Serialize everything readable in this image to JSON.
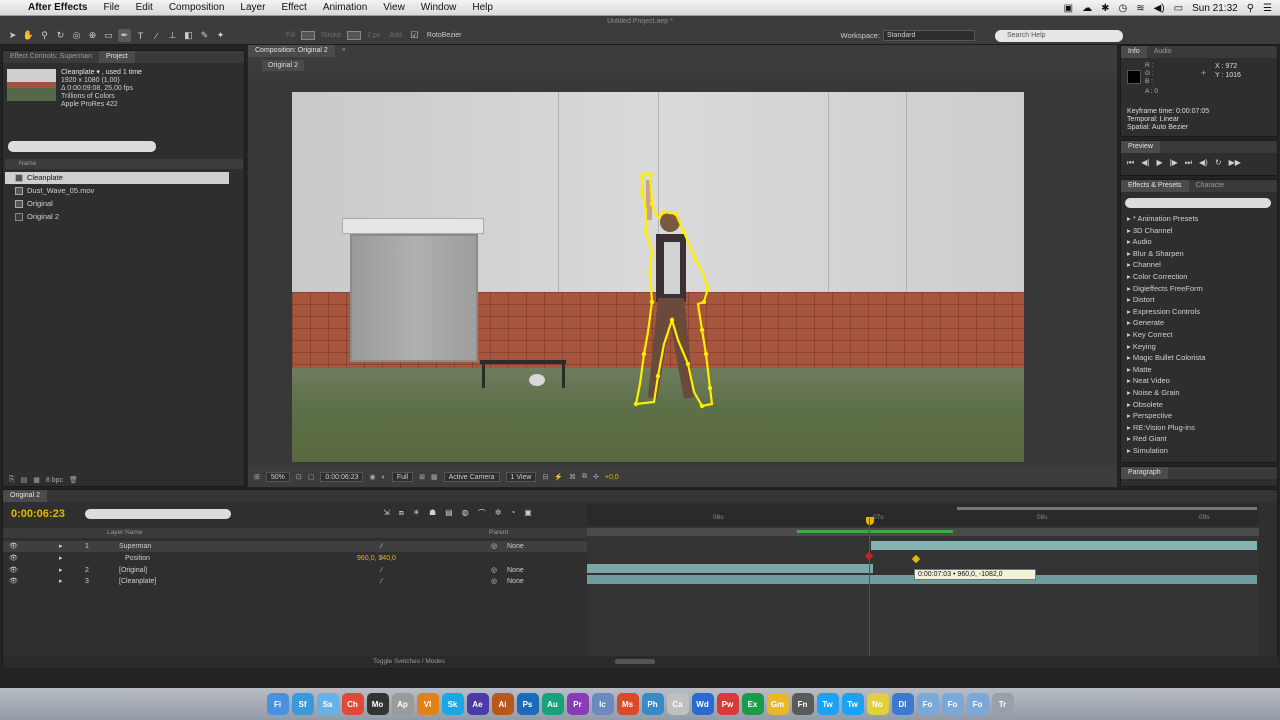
{
  "menubar": {
    "apple_glyph": "",
    "app_name": "After Effects",
    "items": [
      "File",
      "Edit",
      "Composition",
      "Layer",
      "Effect",
      "Animation",
      "View",
      "Window",
      "Help"
    ],
    "clock": "Sun 21:32"
  },
  "window_title": "Untitled Project.aep *",
  "toolbar": {
    "fill_label": "Fill",
    "stroke_label": "Stroke",
    "px_label": "2 px",
    "add_label": "Add",
    "rotobezier_label": "RotoBezier",
    "workspace_label": "Workspace:",
    "workspace_value": "Standard",
    "search_placeholder": "Search Help"
  },
  "project_panel": {
    "tabs": [
      "Effect Controls: Superman",
      "Project"
    ],
    "selected_name": "Cleanplate ▾ , used 1 time",
    "info_lines": [
      "1920 x 1080 (1,00)",
      "Δ 0:00:09:08, 25,00 fps",
      "Trillions of Colors",
      "Apple ProRes 422"
    ],
    "column_name": "Name",
    "items": [
      {
        "name": "Cleanplate",
        "selected": true
      },
      {
        "name": "Dust_Wave_05.mov",
        "selected": false
      },
      {
        "name": "Original",
        "selected": false
      },
      {
        "name": "Original 2",
        "selected": false
      }
    ],
    "bpc": "8 bpc"
  },
  "composition_panel": {
    "tab": "Composition: Original 2",
    "sub_tab": "Original 2",
    "footer": {
      "zoom": "50%",
      "timecode": "0:00:06:23",
      "resolution": "Full",
      "camera": "Active Camera",
      "views": "1 View",
      "exposure": "+0,0"
    }
  },
  "info_panel": {
    "tabs": [
      "Info",
      "Audio"
    ],
    "r": "R :",
    "g": "G :",
    "b": "B :",
    "a": "A : 0",
    "x": "X : 972",
    "y": "Y : 1016",
    "lines": [
      "Keyframe time: 0:00:07:05",
      "Temporal: Linear",
      "Spatial: Auto Bezier"
    ]
  },
  "preview_panel": {
    "tab": "Preview"
  },
  "effects_panel": {
    "tabs": [
      "Effects & Presets",
      "Characte"
    ],
    "items": [
      "* Animation Presets",
      "3D Channel",
      "Audio",
      "Blur & Sharpen",
      "Channel",
      "Color Correction",
      "Digieffects FreeForm",
      "Distort",
      "Expression Controls",
      "Generate",
      "Key Correct",
      "Keying",
      "Magic Bullet Colorista",
      "Matte",
      "Neat Video",
      "Noise & Grain",
      "Obsolete",
      "Perspective",
      "RE:Vision Plug-ins",
      "Red Giant",
      "Simulation"
    ]
  },
  "paragraph_panel": {
    "tab": "Paragraph"
  },
  "timeline": {
    "tab": "Original 2",
    "timecode": "0:00:06:23",
    "col_layer_name": "Layer Name",
    "col_parent": "Parent",
    "layers": [
      {
        "num": "1",
        "name": "Superman",
        "parent": "None",
        "selected": true
      },
      {
        "num": "",
        "name": "Position",
        "value": "960,0, 540,0",
        "parent": "",
        "selected": false
      },
      {
        "num": "2",
        "name": "[Original]",
        "parent": "None",
        "selected": false
      },
      {
        "num": "3",
        "name": "[Cleanplate]",
        "parent": "None",
        "selected": false
      }
    ],
    "ruler_ticks": [
      "06s",
      "07s",
      "08s",
      "09s"
    ],
    "tooltip": "0:00:07:03 • 960,0, -1082,0",
    "toggle_label": "Toggle Switches / Modes"
  },
  "dock": {
    "apps": [
      "Fi",
      "Sf",
      "Sa",
      "Ch",
      "Mo",
      "Ap",
      "Vl",
      "Sk",
      "Ae",
      "Ai",
      "Ps",
      "Au",
      "Pr",
      "Ic",
      "Ms",
      "Ph",
      "Ca",
      "Wd",
      "Pw",
      "Ex",
      "Gm",
      "Fn",
      "Tw",
      "Tw",
      "No",
      "Dl",
      "Fo",
      "Fo",
      "Fo",
      "Tr"
    ],
    "colors": [
      "#4a8fe0",
      "#3a9ad9",
      "#66b2e8",
      "#e0493a",
      "#333333",
      "#9a9a9a",
      "#e0821a",
      "#18a8e6",
      "#4b3ba6",
      "#b8581a",
      "#1a6bb8",
      "#18a27a",
      "#8a3bb8",
      "#6a8ac0",
      "#d84a2a",
      "#3a8ac8",
      "#c0c0c0",
      "#2a6ad0",
      "#d83a3a",
      "#1a9a4a",
      "#e6b82a",
      "#5a5a5a",
      "#1da1f2",
      "#1da1f2",
      "#e0d040",
      "#3a7ad0",
      "#7aa8d8",
      "#7aa8d8",
      "#7aa8d8",
      "#9aa0a8"
    ]
  }
}
